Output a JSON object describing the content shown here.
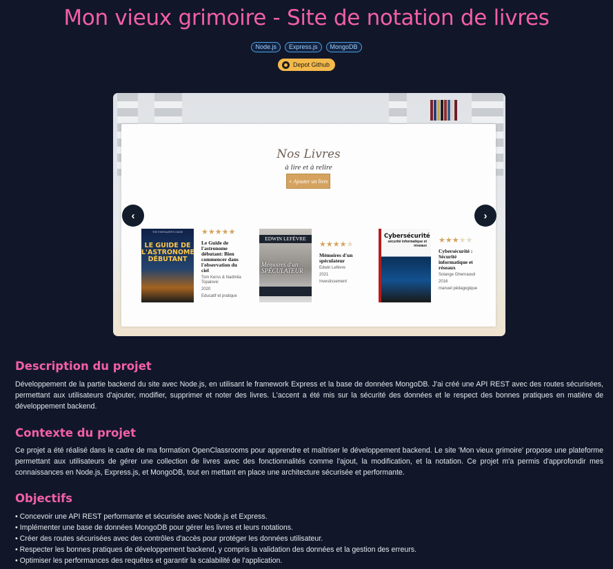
{
  "header": {
    "title": "Mon vieux grimoire - Site de notation de livres",
    "tags": [
      "Node.js",
      "Express.js",
      "MongoDB"
    ],
    "github_label": "Depot Github"
  },
  "carousel": {
    "heading": "Nos Livres",
    "subheading": "à lire et à relire",
    "add_label": "+ Ajouter un livre",
    "prev_icon": "‹",
    "next_icon": "›",
    "books": [
      {
        "title": "Le Guide de l'astronome débutant: Bien commencer dans l'observation du ciel",
        "author": "Tom Kerss & Nadmila Topalovic",
        "year": "2020",
        "genre": "Educatif et pratique",
        "rating": 5,
        "cover_text": "LE GUIDE DE L'ASTRONOME DÉBUTANT"
      },
      {
        "title": "Mémoires d'un spéculateur",
        "author": "Edwin Lefèvre",
        "year": "2021",
        "genre": "Investissement",
        "rating": 4,
        "cover_text": "EDWIN LEFÈVRE",
        "cover_subtext": "Mémoires d'un SPÉCULATEUR"
      },
      {
        "title": "Cybersécurité : Sécurité informatique et réseaux",
        "author": "Solange Ghernaouti",
        "year": "2016",
        "genre": "manuel pédagogique",
        "rating": 3,
        "cover_text": "Cybersécurité",
        "cover_subtext": "sécurité informatique et réseaux"
      }
    ]
  },
  "description": {
    "heading": "Description du projet",
    "text": "Développement de la partie backend du site avec Node.js, en utilisant le framework Express et la base de données MongoDB. J'ai créé une API REST avec des routes sécurisées, permettant aux utilisateurs d'ajouter, modifier, supprimer et noter des livres. L'accent a été mis sur la sécurité des données et le respect des bonnes pratiques en matière de développement backend."
  },
  "context": {
    "heading": "Contexte du projet",
    "text": "Ce projet a été réalisé dans le cadre de ma formation OpenClassrooms pour apprendre et maîtriser le développement backend. Le site 'Mon vieux grimoire' propose une plateforme permettant aux utilisateurs de gérer une collection de livres avec des fonctionnalités comme l'ajout, la modification, et la notation. Ce projet m'a permis d'approfondir mes connaissances en Node.js, Express.js, et MongoDB, tout en mettant en place une architecture sécurisée et performante."
  },
  "objectives": {
    "heading": "Objectifs",
    "items": [
      "Concevoir une API REST performante et sécurisée avec Node.js et Express.",
      "Implémenter une base de données MongoDB pour gérer les livres et leurs notations.",
      "Créer des routes sécurisées avec des contrôles d'accès pour protéger les données utilisateur.",
      "Respecter les bonnes pratiques de développement backend, y compris la validation des données et la gestion des erreurs.",
      "Optimiser les performances des requêtes et garantir la scalabilité de l'application."
    ]
  },
  "colors": {
    "background": "#111729",
    "accent": "#f35fa8",
    "tag_border": "#4da3e8",
    "github_button": "#f4b94b",
    "star": "#d5a35f"
  }
}
